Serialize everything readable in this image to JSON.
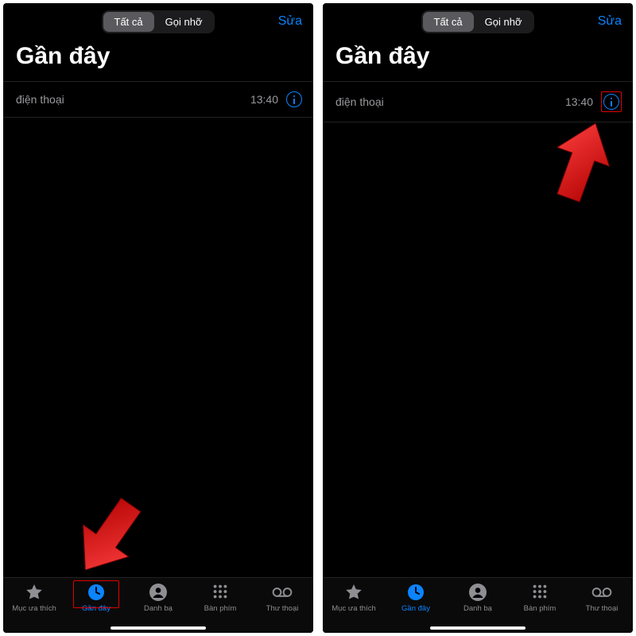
{
  "common": {
    "seg_all": "Tất cả",
    "seg_missed": "Gọi nhỡ",
    "edit": "Sửa",
    "title": "Gần đây",
    "row_caller": "điện thoại",
    "row_time": "13:40",
    "tabs": {
      "fav": "Mục ưa thích",
      "recent": "Gần đây",
      "contacts": "Danh bạ",
      "keypad": "Bàn phím",
      "voicemail": "Thư thoại"
    }
  },
  "colors": {
    "accent": "#0a84ff",
    "highlight": "#e00000",
    "muted": "#8e8e93"
  },
  "panels": [
    {
      "highlight_tab": true,
      "highlight_info": false,
      "arrow": "bottom-left"
    },
    {
      "highlight_tab": false,
      "highlight_info": true,
      "arrow": "top-right"
    }
  ]
}
